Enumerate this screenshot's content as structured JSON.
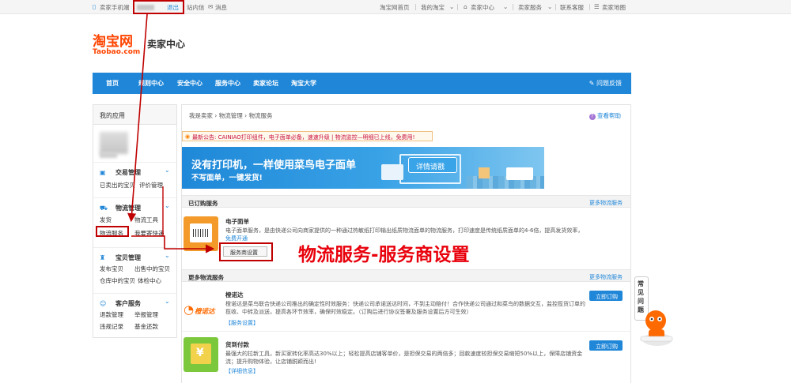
{
  "topbar": {
    "mobile": "卖家手机端",
    "logout": "退出",
    "inbox": "站内信",
    "messages": "消息",
    "home": "淘宝网首页",
    "my_taobao": "我的淘宝",
    "seller_center": "卖家中心",
    "seller_service": "卖家服务",
    "contact": "联系客服",
    "sitemap": "卖家地图"
  },
  "logo": {
    "cn": "淘宝网",
    "en": "Taobao.com",
    "title": "卖家中心"
  },
  "nav": {
    "items": [
      "首页",
      "规则中心",
      "安全中心",
      "服务中心",
      "卖家论坛",
      "淘宝大学"
    ],
    "feedback": "问题反馈"
  },
  "sidebar": {
    "header": "我的应用",
    "trade": {
      "title": "交易管理",
      "links": [
        "已卖出的宝贝",
        "评价管理"
      ]
    },
    "logistics": {
      "title": "物流管理",
      "links": [
        "发货",
        "物流工具",
        "物流服务",
        "我要寄快递"
      ]
    },
    "goods": {
      "title": "宝贝管理",
      "links": [
        "发布宝贝",
        "出售中的宝贝",
        "仓库中的宝贝",
        "体检中心"
      ]
    },
    "customer": {
      "title": "客户服务",
      "links": [
        "退款管理",
        "举报管理",
        "违规记录",
        "基金还款"
      ]
    }
  },
  "main": {
    "breadcrumb": "我是卖家 › 物流管理 › 物流服务",
    "help": "查看帮助",
    "notice": "最新公告: CAINIAO打印组件，电子面单必备，速速升级 | 物流监控—明细已上线，免费用!",
    "banner": {
      "line1": "没有打印机，一样使用菜鸟电子面单",
      "line2": "不写面单，一键发货!",
      "button": "详情请戳"
    },
    "subscribed": {
      "title": "已订购服务",
      "more": "更多物流服务"
    },
    "ewaybill": {
      "name": "电子面单",
      "desc": "电子面单服务，是由快递公司向商家提供的一种通过热敏纸打印输出纸质物流面单的物流服务，打印速度是传统纸质面单的4-6倍，提高发货效率，",
      "link": "免费开通",
      "button": "服务商设置"
    },
    "more_services": {
      "title": "更多物流服务",
      "more": "更多物流服务"
    },
    "chengnuoda": {
      "name": "橙诺达",
      "desc": "橙诺达是菜鸟联合快递公司推出的确定性时效服务：快递公司承诺送达时间，不到主动赔付！合作快递公司通过和菜鸟的数据交互，监控揽货订单的揽收、中转及派送，提高各环节效率，确保时效稳定。（订购后进行协议签署及服务设置后方可生效）",
      "link": "【服务设置】",
      "button": "立即订购",
      "logo": "橙诺达"
    },
    "cod": {
      "name": "货到付款",
      "desc": "最强大的拉新工具，新买家转化率高达30%以上；轻松提高店铺客单价，是担保交易的两倍多；回款速度较担保交易缩短50%以上，保障店铺资金流；提升购物体验，让店铺脱颖而出!",
      "link": "【详细信息】",
      "button": "立即订购"
    }
  },
  "annotation": "物流服务-服务商设置",
  "widget": {
    "faq": "常见问题"
  },
  "colors": {
    "brand": "#ff4400",
    "nav": "#1f86d8",
    "annotation": "#e8000b"
  }
}
